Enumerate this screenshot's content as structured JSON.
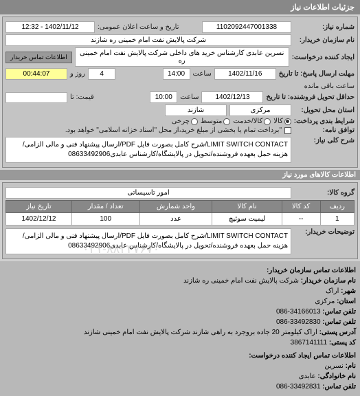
{
  "header": {
    "title": "جزئیات اطلاعات نیاز"
  },
  "form": {
    "request_no_label": "شماره نیاز:",
    "request_no": "1102092447001338",
    "announce_label": "تاریخ و ساعت اعلان عمومی:",
    "announce": "1402/11/12 - 12:32",
    "buyer_name_label": "نام سازمان خریدار:",
    "buyer_name": "شرکت پالایش نفت امام خمینی  ره  شازند",
    "requester_label": "ایجاد کننده درخواست:",
    "requester": "نسرین عابدی کارشناس خرید های داخلی  شرکت پالایش نفت امام خمینی  ره",
    "contact_btn": "اطلاعات تماس خریدار",
    "deadline_label": "مهلت ارسال پاسخ: تا تاریخ",
    "deadline_date": "1402/11/16",
    "time_label": "ساعت",
    "deadline_time": "14:00",
    "countdown_days": "4",
    "countdown_day_label": "روز و",
    "countdown_time": "00:44:07",
    "countdown_remain": "ساعت باقی مانده",
    "delivery_label": "حداقل تحویل فروشنده: تا تاریخ",
    "delivery_date": "1402/12/13",
    "delivery_time": "10:00",
    "price_label": "قیمت: تا",
    "location_label": "استان محل تحویل:",
    "province": "مرکزی",
    "city": "شازند",
    "bid_type_label": "شرایط بندی پرداخت:",
    "bid_warehouse": "کالا/خدمت",
    "bid_recv": "متوسط",
    "bid_cash": "چرخی",
    "agreement_label": "توافق نامه:",
    "agreement_text": "\"برداخت تمام یا بخشی از مبلغ خرید،از محل \"اسناد خزانه اسلامی\" خواهد بود.",
    "kala_label": "کالا",
    "desc_header": "شرح کلی نیاز:",
    "desc_text": "LIMIT SWITCH CONTACT/شرح کامل بصورت فایل PDF/ارسال پیشنهاد فنی و مالی الزامی/هزینه حمل بعهده فروشنده/تحویل در پالایشگاه/کارشناس عابدی08633492906"
  },
  "goods": {
    "header": "اطلاعات کالاهای مورد نیاز",
    "group_label": "گروه کالا:",
    "group_value": "امور تاسیساتی",
    "columns": {
      "row": "ردیف",
      "code": "کد کالا",
      "name": "نام کالا",
      "unit": "واحد شمارش",
      "qty": "تعداد / مقدار",
      "date": "تاریخ نیاز"
    },
    "rows": [
      {
        "row": "1",
        "code": "--",
        "name": "لیمیت سوئیچ",
        "unit": "عدد",
        "qty": "100",
        "date": "1402/12/12"
      }
    ],
    "buyer_note_label": "توضیحات خریدار:",
    "buyer_note": "LIMIT SWITCH CONTACT/شرح کامل بصورت فایل PDF/ارسال پیشنهاد فنی و مالی الزامی/هزینه حمل بعهده فروشنده/تحویل در پالایشگاه/کارشناس عابدی08633492906"
  },
  "contact": {
    "header": "اطلاعات تماس سازمان خریدار:",
    "org_label": "نام سازمان خریدار:",
    "org": "شرکت پالایش نفت امام خمینی ره شازند",
    "city_label": "شهر:",
    "city": "اراک",
    "province_label": "استان:",
    "province": "مرکزی",
    "phone_label": "تلفن تماس:",
    "phone": "34166013-086",
    "fax_label": "تلفن تماس:",
    "fax": "33492830-086",
    "addr_label": "آدرس پستی:",
    "addr": "اراک کیلومتر 20 جاده بروجرد به راهی شازند شرکت پالایش نفت امام خمینی شازند",
    "post_label": "کد پستی:",
    "post": "3867141111",
    "req_header": "اطلاعات تماس ایجاد کننده درخواست:",
    "req_name_label": "نام:",
    "req_name": "نسرین",
    "req_family_label": "نام خانوادگی:",
    "req_family": "عابدی",
    "req_phone_label": "تلفن تماس:",
    "req_phone": "33492831-086"
  },
  "watermark": "۰۲۱-۸۸۲۴۷۶۷۰"
}
